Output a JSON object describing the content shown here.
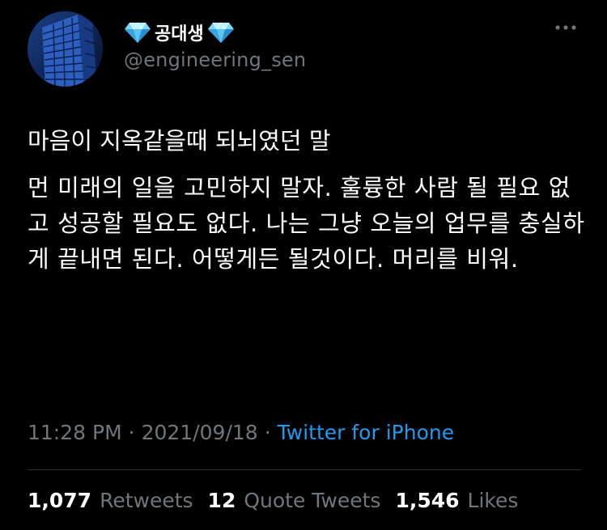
{
  "tweet": {
    "author": {
      "display_name": "공대생",
      "handle": "@engineering_sen",
      "badge_icon": "diamond-icon",
      "avatar_description_icon": "building-avatar"
    },
    "menu_icon": "more-horizontal-icon",
    "text_paragraphs": [
      "마음이 지옥같을때 되뇌였던 말",
      "먼 미래의 일을 고민하지 말자. 훌륭한 사람 될 필요 없고 성공할 필요도 없다. 나는 그냥 오늘의 업무를 충실하게 끝내면 된다. 어떻게든 될것이다. 머리를 비워."
    ],
    "time": "11:28 PM",
    "date": "2021/09/18",
    "separator": "·",
    "source": "Twitter for iPhone"
  },
  "stats": {
    "retweets": {
      "count": "1,077",
      "label": "Retweets"
    },
    "quotes": {
      "count": "12",
      "label": "Quote Tweets"
    },
    "likes": {
      "count": "1,546",
      "label": "Likes"
    }
  },
  "colors": {
    "background": "#000000",
    "text": "#ffffff",
    "muted": "#71767b",
    "link": "#1d9bf0",
    "divider": "#2f3336",
    "gem": "#4fc3f7"
  }
}
